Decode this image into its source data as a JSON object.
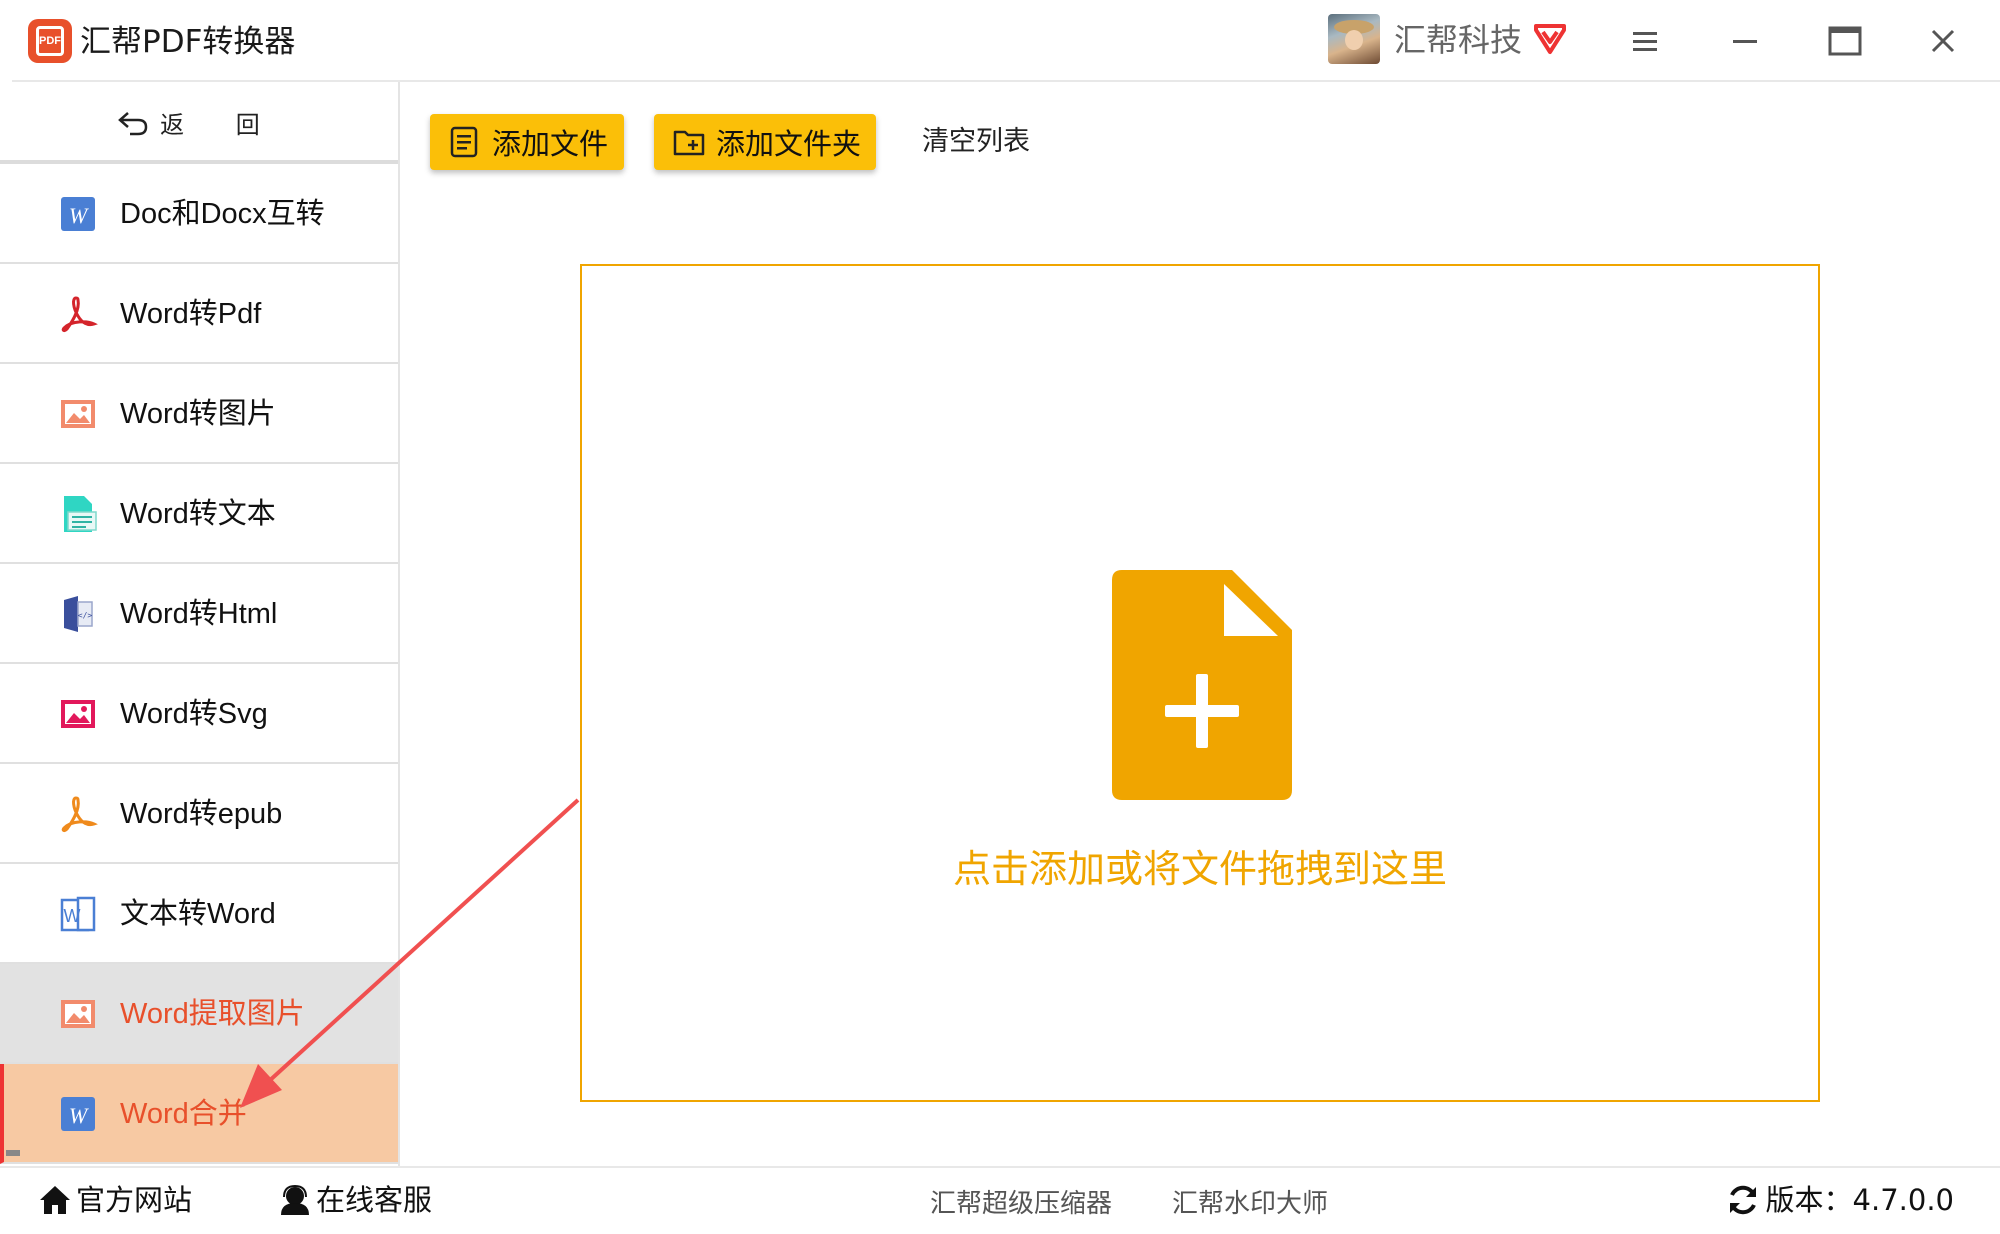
{
  "app": {
    "title": "汇帮PDF转换器",
    "logo_text": "PDF",
    "accent_color": "#fbbf08",
    "highlight_color": "#e8502b"
  },
  "user": {
    "name": "汇帮科技",
    "vip_icon": "diamond-icon"
  },
  "window_controls": [
    "menu-icon",
    "minimize-icon",
    "maximize-icon",
    "close-icon"
  ],
  "sidebar": {
    "back_label": "返 回",
    "items": [
      {
        "label": "Doc和Docx互转",
        "icon": "word-icon",
        "state": "normal"
      },
      {
        "label": "Word转Pdf",
        "icon": "pdf-acrobat-icon",
        "state": "normal"
      },
      {
        "label": "Word转图片",
        "icon": "image-icon",
        "state": "normal"
      },
      {
        "label": "Word转文本",
        "icon": "text-doc-icon",
        "state": "normal"
      },
      {
        "label": "Word转Html",
        "icon": "html-icon",
        "state": "normal"
      },
      {
        "label": "Word转Svg",
        "icon": "svg-image-icon",
        "state": "normal"
      },
      {
        "label": "Word转epub",
        "icon": "epub-icon",
        "state": "normal"
      },
      {
        "label": "文本转Word",
        "icon": "text-to-word-icon",
        "state": "normal"
      },
      {
        "label": "Word提取图片",
        "icon": "image-icon",
        "state": "hover"
      },
      {
        "label": "Word合并",
        "icon": "word-icon",
        "state": "active"
      }
    ]
  },
  "toolbar": {
    "add_file_label": "添加文件",
    "add_folder_label": "添加文件夹",
    "clear_label": "清空列表"
  },
  "dropzone": {
    "text": "点击添加或将文件拖拽到这里",
    "color": "#f0a500"
  },
  "footer": {
    "website_label": "官方网站",
    "support_label": "在线客服",
    "tool_compressor": "汇帮超级压缩器",
    "tool_watermark": "汇帮水印大师",
    "version_label": "版本：4.7.0.0"
  }
}
